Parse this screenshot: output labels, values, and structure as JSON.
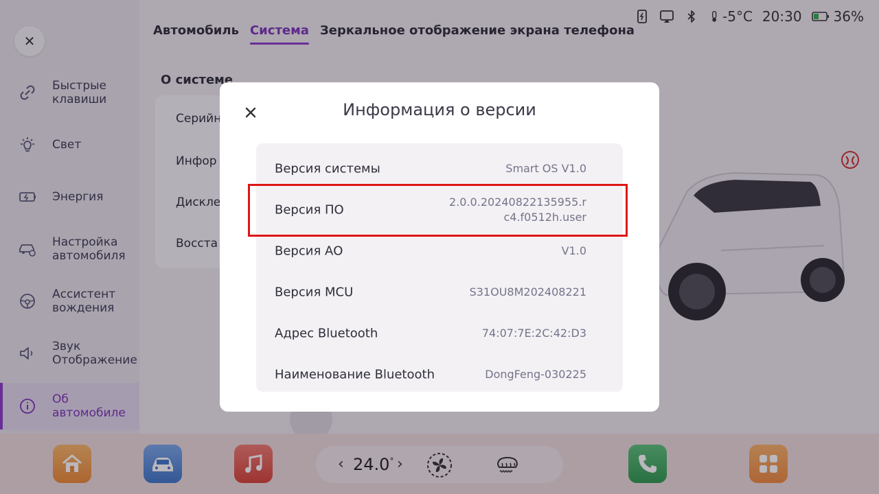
{
  "tabs": [
    {
      "label": "Автомобиль",
      "active": false
    },
    {
      "label": "Система",
      "active": true
    },
    {
      "label": "Зеркальное отображение экрана телефона",
      "active": false
    }
  ],
  "status_bar": {
    "temperature": "-5°C",
    "time": "20:30",
    "battery": "36%",
    "icons": [
      "phone-charging-icon",
      "screen-cast-icon",
      "bluetooth-icon",
      "thermometer-icon",
      "battery-icon"
    ]
  },
  "sidebar": {
    "items": [
      {
        "label": "Быстрые\nклавиши",
        "icon": "link-icon",
        "active": false
      },
      {
        "label": "Свет",
        "icon": "light-icon",
        "active": false
      },
      {
        "label": "Энергия",
        "icon": "battery-icon",
        "active": false
      },
      {
        "label": "Настройка\nавтомобиля",
        "icon": "car-settings-icon",
        "active": false
      },
      {
        "label": "Ассистент\nвождения",
        "icon": "steering-wheel-icon",
        "active": false
      },
      {
        "label": "Звук\nОтображение",
        "icon": "speaker-icon",
        "active": false
      },
      {
        "label": "Об\nавтомобиле",
        "icon": "info-icon",
        "active": true
      }
    ]
  },
  "system": {
    "title": "О системе",
    "rows": [
      "Серийн",
      "Инфор",
      "Дискле",
      "Восста"
    ]
  },
  "modal": {
    "title": "Информация о версии",
    "rows": [
      {
        "key": "Версия системы",
        "value": "Smart OS V1.0"
      },
      {
        "key": "Версия ПО",
        "value": "2.0.0.20240822135955.r\nc4.f0512h.user",
        "highlighted": true
      },
      {
        "key": "Версия АО",
        "value": "V1.0"
      },
      {
        "key": "Версия MCU",
        "value": "S31OU8M202408221"
      },
      {
        "key": "Адрес Bluetooth",
        "value": "74:07:7E:2C:42:D3"
      },
      {
        "key": "Наименование Bluetooth",
        "value": "DongFeng-030225"
      }
    ]
  },
  "dock": {
    "temperature": "24.0",
    "temperature_unit": "°",
    "apps": [
      "home-app-icon",
      "car-app-icon",
      "music-app-icon",
      "phone-app-icon",
      "apps-grid-icon"
    ]
  },
  "colors": {
    "accent": "#8a3dc8",
    "highlight_border": "#e01414",
    "home_app": "#f2a24a",
    "car_app": "#5b8fd6",
    "music_app": "#e2574c",
    "phone_app": "#3aa85a",
    "apps_grid": "#f29a4a"
  }
}
